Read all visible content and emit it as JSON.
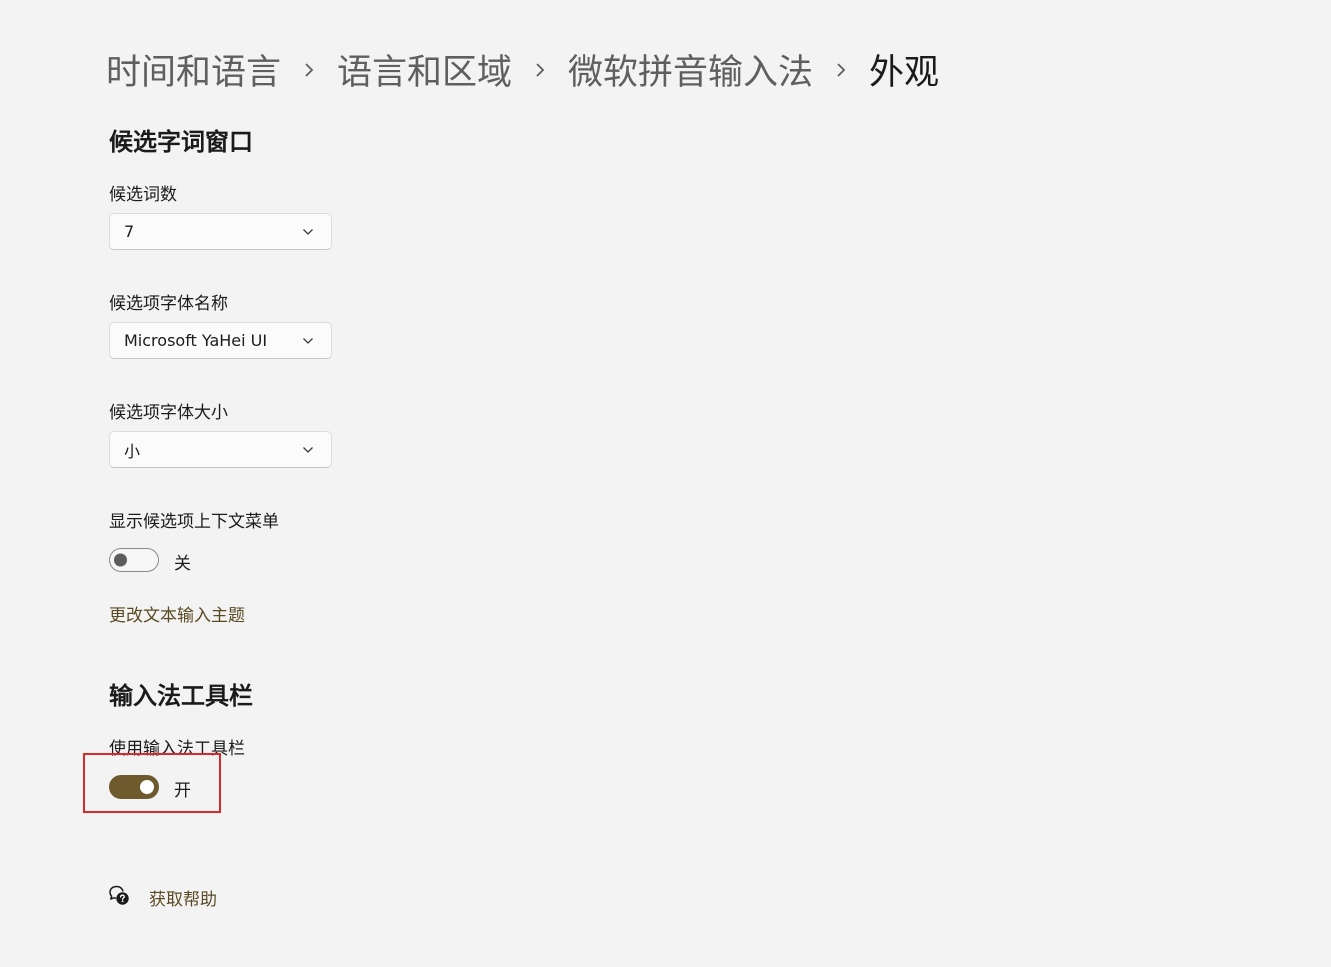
{
  "breadcrumb": {
    "items": [
      "时间和语言",
      "语言和区域",
      "微软拼音输入法"
    ],
    "current": "外观"
  },
  "candidate_window": {
    "title": "候选字词窗口",
    "count": {
      "label": "候选词数",
      "value": "7"
    },
    "font_name": {
      "label": "候选项字体名称",
      "value": "Microsoft YaHei UI"
    },
    "font_size": {
      "label": "候选项字体大小",
      "value": "小"
    },
    "context_menu": {
      "label": "显示候选项上下文菜单",
      "state": "关",
      "on": false
    },
    "theme_link": "更改文本输入主题"
  },
  "toolbar_section": {
    "title": "输入法工具栏",
    "use_toolbar": {
      "label": "使用输入法工具栏",
      "state": "开",
      "on": true
    }
  },
  "help": {
    "label": "获取帮助",
    "icon": "help-chat-icon"
  },
  "colors": {
    "accent": "#6f5a2e",
    "link": "#5a4a23",
    "highlight": "#d9292b",
    "background": "#f3f3f3"
  }
}
